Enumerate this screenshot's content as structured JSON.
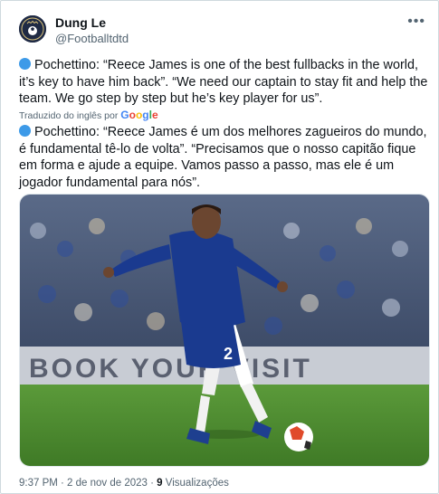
{
  "author": {
    "display_name": "Dung Le",
    "handle": "@Footballtdtd",
    "avatar_text": "CAPTAIN FOOTBALL"
  },
  "tweet": {
    "original_text": "Pochettino: “Reece James is one of the best fullbacks in the world, it’s key to have him back”.  “We need our captain to stay fit and help the team. We go step by step but he’s key player for us”.",
    "translated_label": "Traduzido do inglês por",
    "translated_provider": "Google",
    "translated_text": "Pochettino: “Reece James é um dos melhores zagueiros do mundo, é fundamental tê-lo de volta”. “Precisamos que o nosso capitão fique em forma e ajude a equipe. Vamos passo a passo, mas ele é um jogador fundamental para nós”."
  },
  "media": {
    "banner_text": "BOOK YOUR VISIT",
    "shirt_number": "2"
  },
  "footer": {
    "timestamp": "9:37 PM · 2 de nov de 2023 · ",
    "views_count": "9",
    "views_label": " Visualizações"
  },
  "colors": {
    "accent": "#1d9bf0",
    "kit_blue": "#1a3a8f",
    "pitch": "#4a8a2e"
  }
}
